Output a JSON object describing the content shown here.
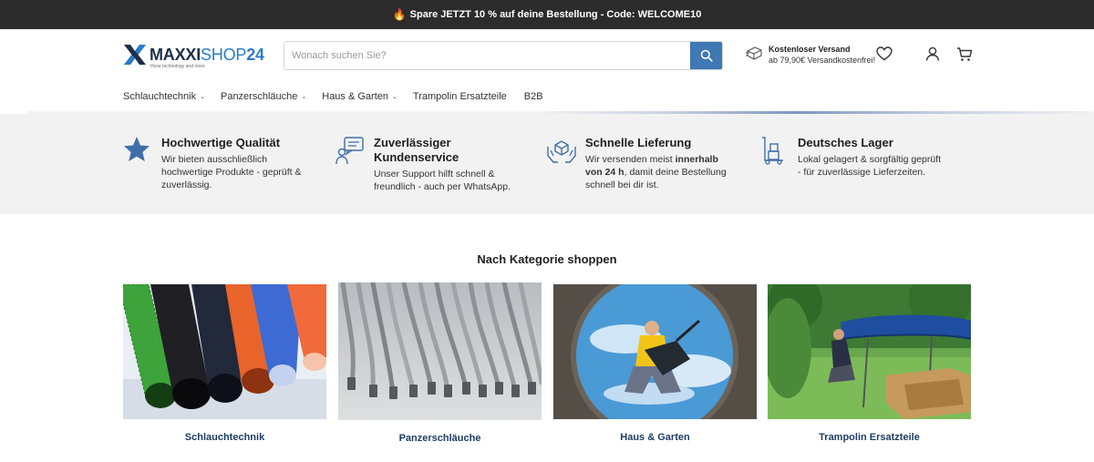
{
  "promo": {
    "icon": "flame-icon",
    "text": "Spare JETZT 10 % auf deine Bestellung - Code: WELCOME10"
  },
  "logo": {
    "maxxi": "MAXXI",
    "shop": "SHOP",
    "num": "24",
    "tagline": "Hose technology and more"
  },
  "search": {
    "placeholder": "Wonach suchen Sie?",
    "button_icon": "search-icon"
  },
  "shipping": {
    "title": "Kostenloser Versand",
    "subtitle": "ab 79,90€ Versandkostenfrei!",
    "icon": "shipping-icon"
  },
  "header_icons": [
    "heart-icon",
    "user-icon",
    "cart-icon"
  ],
  "nav": [
    {
      "label": "Schlauchtechnik",
      "dropdown": true
    },
    {
      "label": "Panzerschläuche",
      "dropdown": true
    },
    {
      "label": "Haus & Garten",
      "dropdown": true
    },
    {
      "label": "Trampolin Ersatzteile",
      "dropdown": false
    },
    {
      "label": "B2B",
      "dropdown": false
    }
  ],
  "features": [
    {
      "icon": "star-icon",
      "title": "Hochwertige Qualität",
      "desc": "Wir bieten ausschließlich hochwertige Produkte - geprüft & zuverlässig."
    },
    {
      "icon": "support-icon",
      "title": "Zuverlässiger Kundenservice",
      "desc": "Unser Support hilft schnell & freundlich - auch per WhatsApp."
    },
    {
      "icon": "delivery-hands-icon",
      "title": "Schnelle Lieferung",
      "desc_pre": "Wir versenden meist ",
      "desc_bold": "innerhalb von 24 h",
      "desc_post": ", damit deine Bestellung schnell bei dir ist."
    },
    {
      "icon": "warehouse-icon",
      "title": "Deutsches Lager",
      "desc": "Lokal gelagert & sorgfältig geprüft - für zuverlässige Lieferzeiten."
    }
  ],
  "section_title": "Nach Kategorie shoppen",
  "categories": [
    {
      "label": "Schlauchtechnik"
    },
    {
      "label": "Panzerschläuche"
    },
    {
      "label": "Haus & Garten"
    },
    {
      "label": "Trampolin Ersatzteile"
    }
  ],
  "colors": {
    "accent": "#3f78b5",
    "brand_dark": "#1d2f4a",
    "brand_blue": "#2a7cc8",
    "promo_bg": "#2c2c2c",
    "feature_bg": "#f2f2f2",
    "category_label": "#1e3d66"
  }
}
